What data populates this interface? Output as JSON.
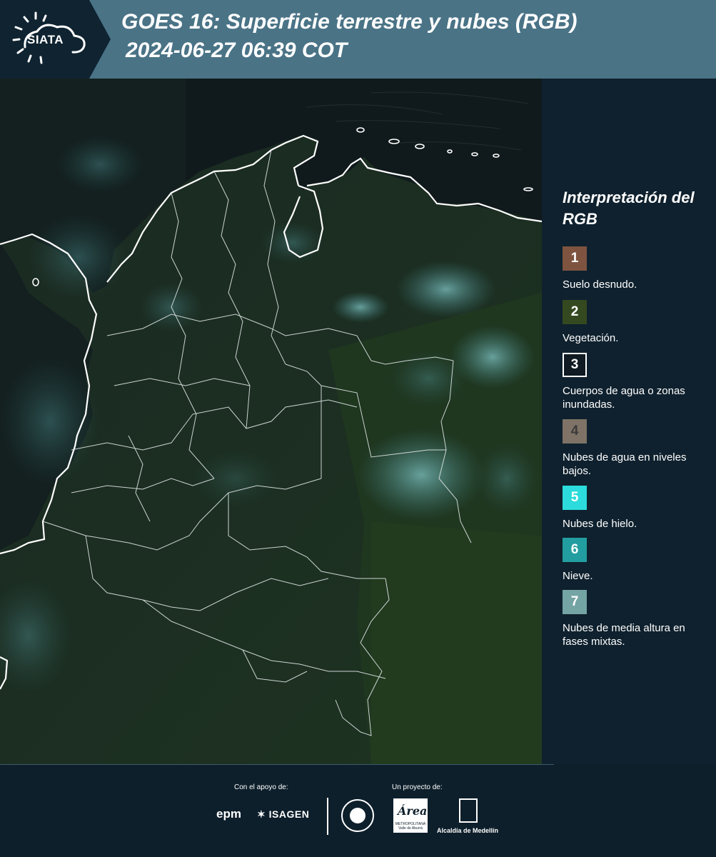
{
  "header": {
    "logo_text": "SIATA",
    "title": "GOES 16: Superficie terrestre y nubes (RGB)",
    "subtitle": "2024-06-27 06:39 COT"
  },
  "legend": {
    "title": "Interpretación del RGB",
    "items": [
      {
        "num": "1",
        "label": "Suelo desnudo.",
        "color": "#7e5440"
      },
      {
        "num": "2",
        "label": "Vegetación.",
        "color": "#34491f"
      },
      {
        "num": "3",
        "label": "Cuerpos de agua o zonas inundadas.",
        "color": "#0f1a22"
      },
      {
        "num": "4",
        "label": "Nubes de agua en niveles bajos.",
        "color": "#7e7366"
      },
      {
        "num": "5",
        "label": "Nubes de hielo.",
        "color": "#2cdcdc"
      },
      {
        "num": "6",
        "label": "Nieve.",
        "color": "#229ea0"
      },
      {
        "num": "7",
        "label": "Nubes de media altura en fases mixtas.",
        "color": "#74a4a4"
      }
    ]
  },
  "footer": {
    "support_label": "Con el apoyo de:",
    "project_label": "Un proyecto de:",
    "sponsors": {
      "epm": "epm",
      "isagen": "ISAGEN"
    },
    "partners": {
      "area_text": "Área",
      "area_name": "METROPOLITANA Valle de Aburrá",
      "alcaldia": "Alcaldía de Medellín"
    }
  },
  "colors": {
    "header_bg": "#4a7386",
    "logo_bg": "#0f2331",
    "legend_bg": "#0f212e",
    "map_land": "#16231f",
    "map_sea": "#0c1418",
    "cloud": "#5fa5a8",
    "border": "#ffffff"
  }
}
